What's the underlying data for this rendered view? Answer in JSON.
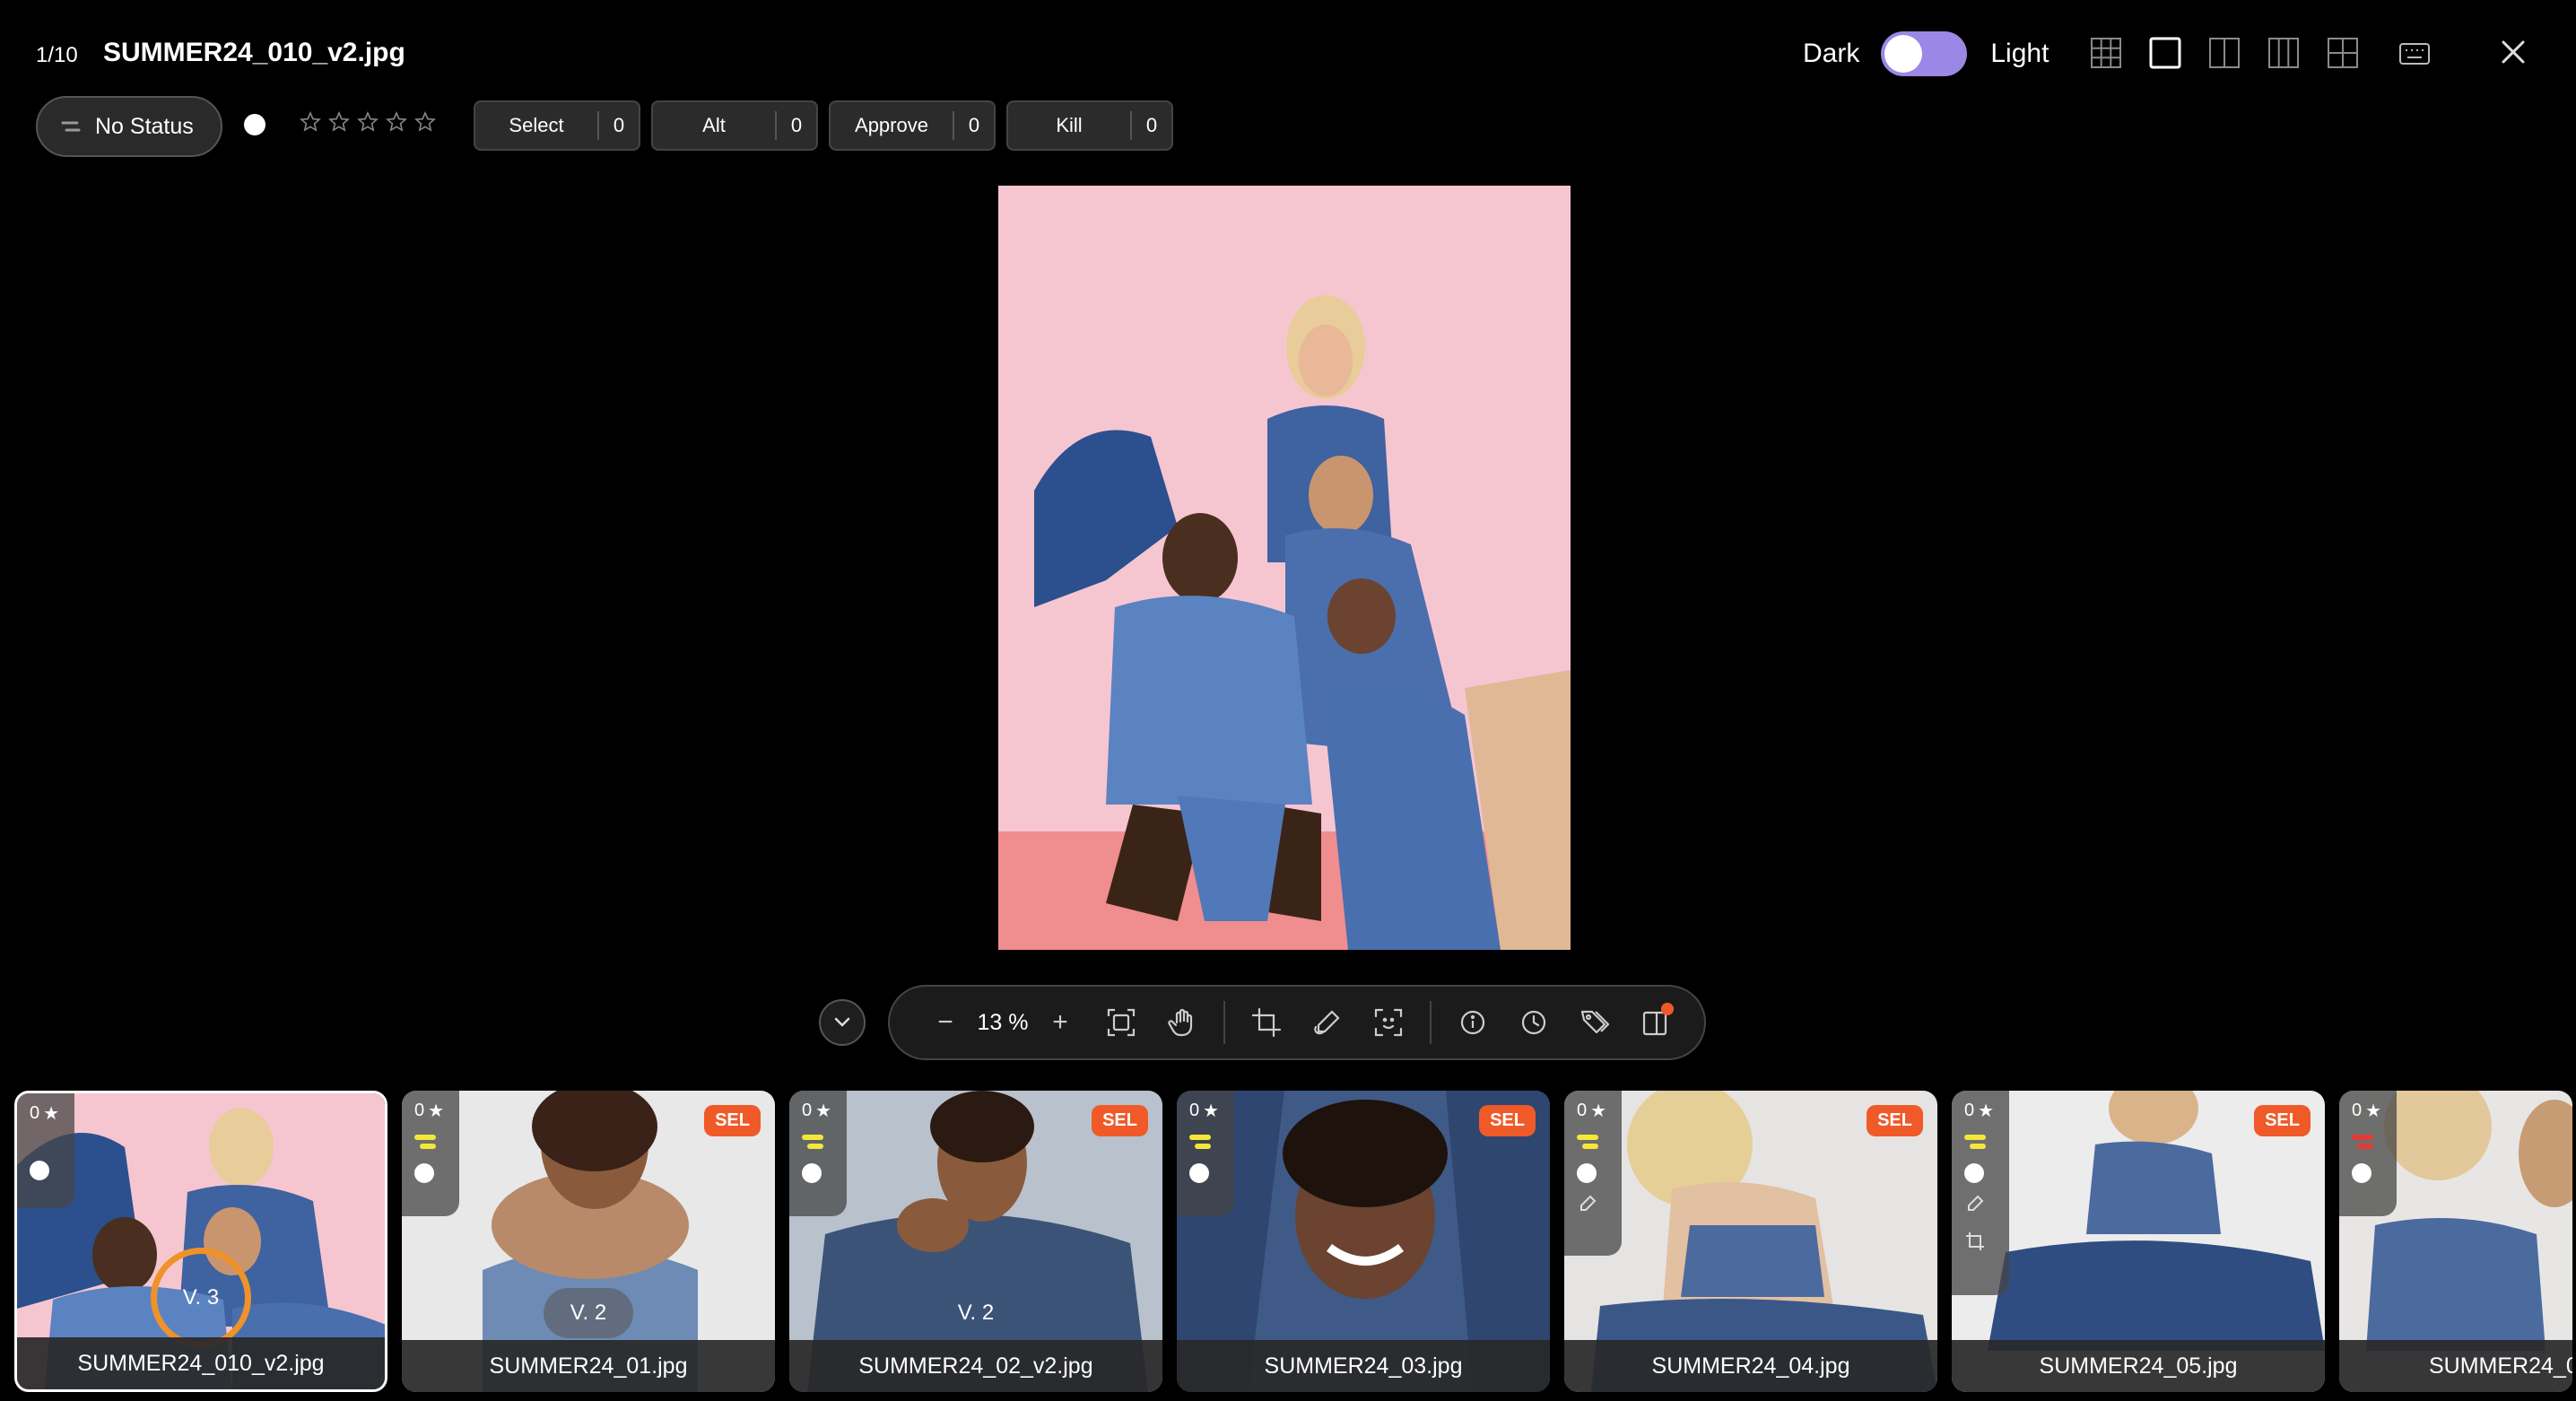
{
  "header": {
    "counter": "1/10",
    "filename": "SUMMER24_010_v2.jpg",
    "theme_dark_label": "Dark",
    "theme_light_label": "Light",
    "view_icons": [
      "grid-view-icon",
      "single-view-icon",
      "split-2-view-icon",
      "split-3-view-icon",
      "quad-view-icon"
    ],
    "keyboard_icon": "keyboard-icon",
    "close_icon": "close-icon"
  },
  "status_bar": {
    "status_label": "No Status",
    "stars_filled": 0,
    "stars_total": 5,
    "counters": [
      {
        "label": "Select",
        "count": "0"
      },
      {
        "label": "Alt",
        "count": "0"
      },
      {
        "label": "Approve",
        "count": "0"
      },
      {
        "label": "Kill",
        "count": "0"
      }
    ]
  },
  "toolbar": {
    "zoom_out": "−",
    "zoom_value": "13 %",
    "zoom_in": "+"
  },
  "colors": {
    "accent_toggle": "#9b87e6",
    "sel_badge": "#f05a28",
    "version_ring": "#f0922a",
    "label_yellow": "#f5e63a",
    "label_red": "#e53935",
    "photo_bg": "#f6c6d0"
  },
  "filmstrip": [
    {
      "name": "SUMMER24_010_v2.jpg",
      "rating": "0",
      "version": "V. 3",
      "sel": "",
      "label": "yellow"
    },
    {
      "name": "SUMMER24_01.jpg",
      "rating": "0",
      "version": "V. 2",
      "sel": "SEL",
      "label": "yellow"
    },
    {
      "name": "SUMMER24_02_v2.jpg",
      "rating": "0",
      "version": "V. 2",
      "sel": "SEL",
      "label": "yellow"
    },
    {
      "name": "SUMMER24_03.jpg",
      "rating": "0",
      "version": "",
      "sel": "SEL",
      "label": "yellow"
    },
    {
      "name": "SUMMER24_04.jpg",
      "rating": "0",
      "version": "",
      "sel": "SEL",
      "label": "yellow"
    },
    {
      "name": "SUMMER24_05.jpg",
      "rating": "0",
      "version": "",
      "sel": "SEL",
      "label": "yellow"
    },
    {
      "name": "SUMMER24_0",
      "rating": "0",
      "version": "",
      "sel": "",
      "label": "red"
    }
  ]
}
